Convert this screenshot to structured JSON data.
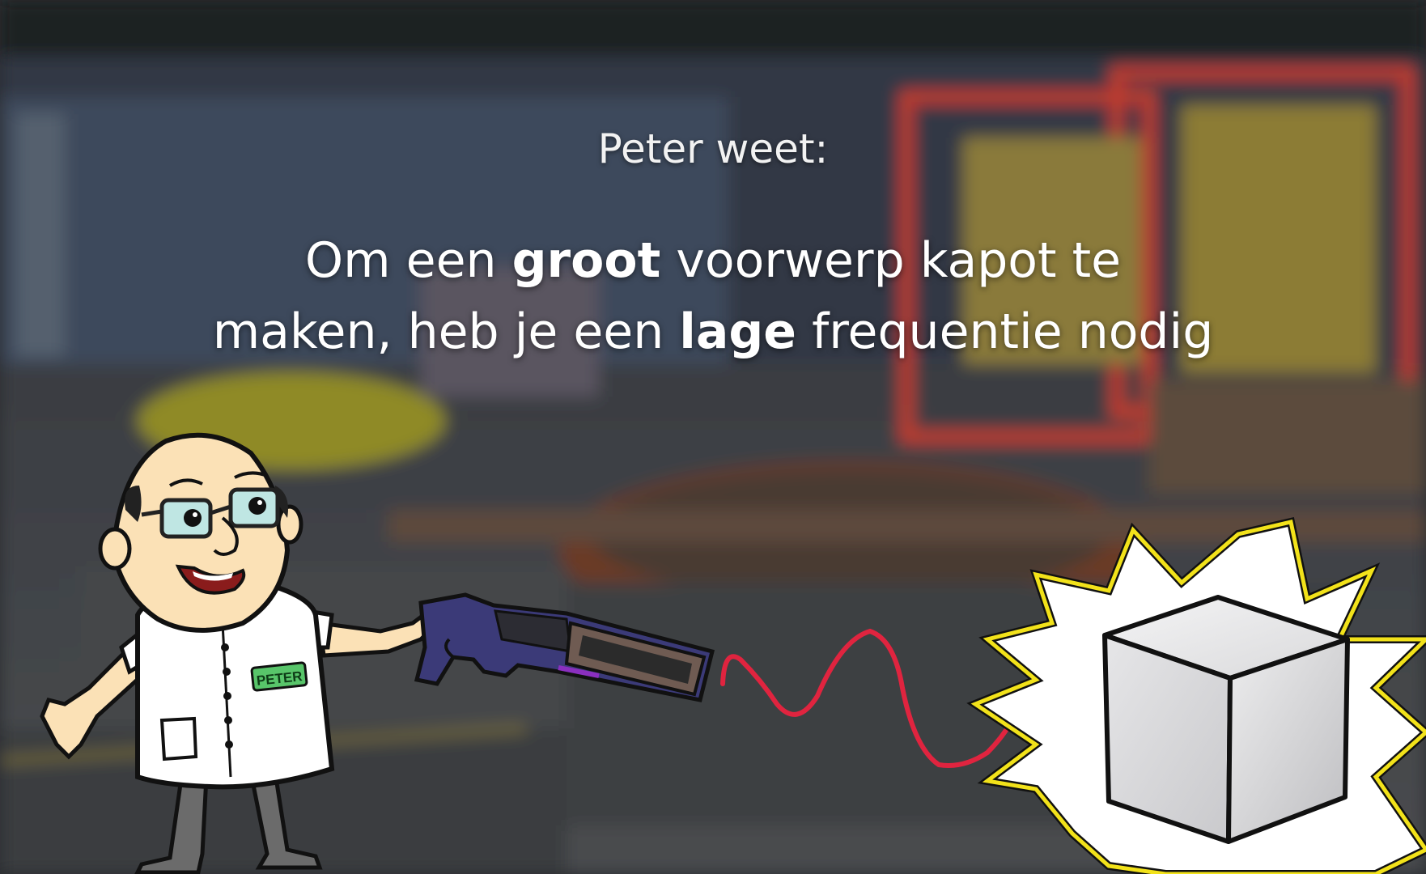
{
  "header": {
    "title": "Peter weet:"
  },
  "fact": {
    "line1_a": "Om een ",
    "line1_bold": "groot",
    "line1_b": " voorwerp kapot te",
    "line2_a": "maken, heb je een ",
    "line2_bold": "lage",
    "line2_b": " frequentie nodig"
  },
  "character": {
    "badge_label": "PETER"
  },
  "colors": {
    "wave": "#e0243f",
    "starburst_outline": "#f2e21a",
    "cube_light": "#e9e9ea"
  },
  "icons": {
    "character": "scientist-character",
    "weapon": "sound-blaster-icon",
    "target": "cube-target-icon",
    "impact": "starburst-icon"
  }
}
